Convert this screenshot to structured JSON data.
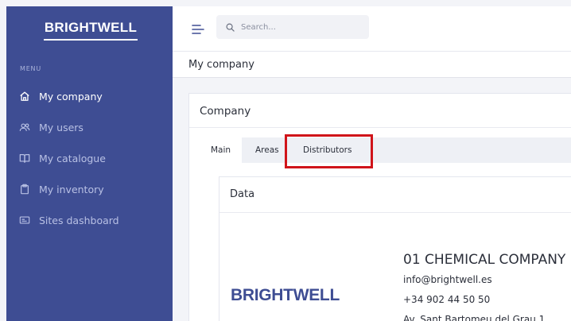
{
  "sidebar": {
    "brand": "BRIGHTWELL",
    "menu_label": "MENU",
    "items": [
      {
        "label": "My company",
        "icon": "home-icon"
      },
      {
        "label": "My users",
        "icon": "users-icon"
      },
      {
        "label": "My catalogue",
        "icon": "book-icon"
      },
      {
        "label": "My inventory",
        "icon": "clipboard-icon"
      },
      {
        "label": "Sites dashboard",
        "icon": "dashboard-icon"
      }
    ],
    "colors": {
      "background": "#3e4d93",
      "active": "#ffffff",
      "inactive": "#b8c0e4"
    }
  },
  "topbar": {
    "search_placeholder": "Search..."
  },
  "breadcrumb": {
    "title": "My company"
  },
  "card": {
    "title": "Company",
    "tabs": [
      {
        "label": "Main",
        "active": true
      },
      {
        "label": "Areas",
        "active": false
      },
      {
        "label": "Distributors",
        "active": false
      }
    ],
    "highlight_color": "#d0141a"
  },
  "panel": {
    "title": "Data",
    "logo_text": "BRIGHTWELL",
    "company_name": "01 CHEMICAL COMPANY",
    "email": "info@brightwell.es",
    "phone": "+34 902 44 50 50",
    "address": "Av. Sant Bartomeu del Grau 1"
  }
}
